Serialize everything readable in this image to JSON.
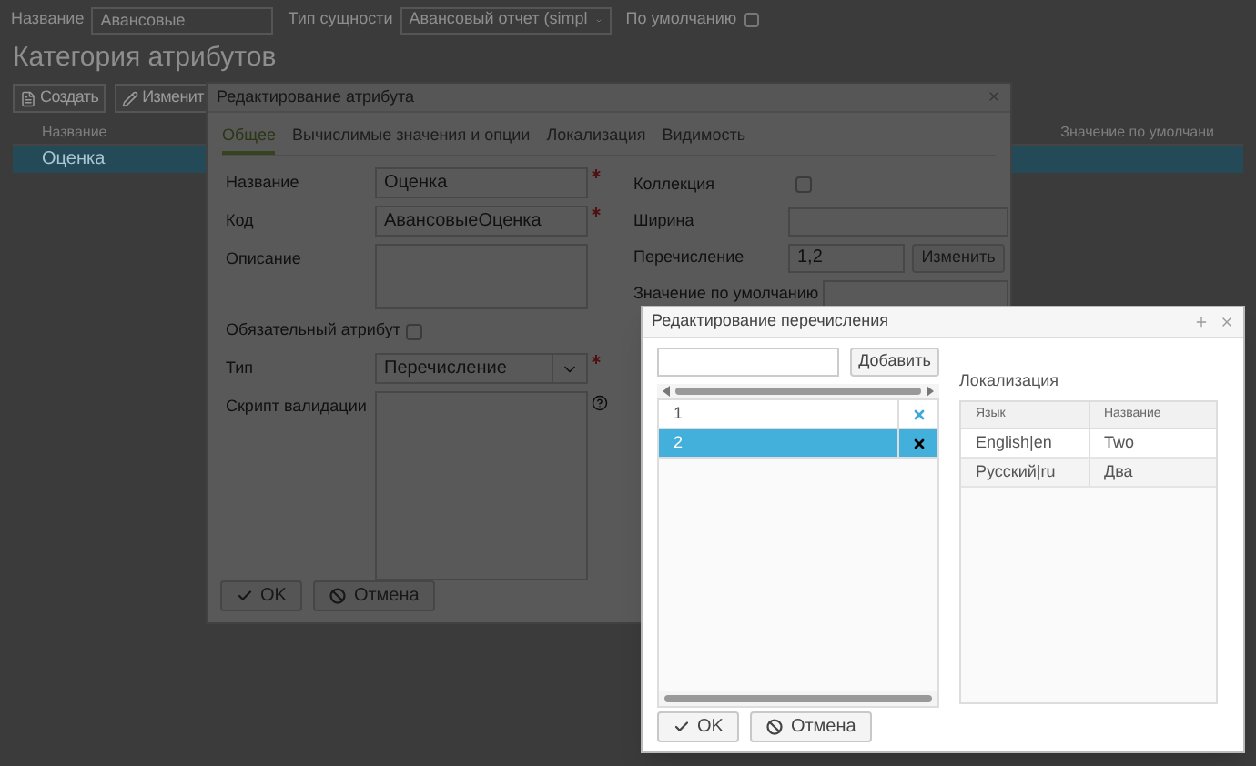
{
  "page": {
    "filters": [
      {
        "kind": "text",
        "label": "Название",
        "value": "Авансовые"
      },
      {
        "kind": "select",
        "label": "Тип сущности",
        "value": "Авансовый отчет (simpl"
      },
      {
        "kind": "checkbox",
        "label": "По умолчанию",
        "checked": false
      }
    ],
    "title": "Категория атрибутов",
    "buttons": [
      {
        "kind": "create",
        "label": "Создать"
      },
      {
        "kind": "edit",
        "label": "Изменит"
      }
    ],
    "table": {
      "columns": [
        "Название",
        "Значение по умолчани"
      ],
      "rows": [
        {
          "cells": [
            "Оценка"
          ],
          "selected": true
        }
      ]
    }
  },
  "attribute_dialog": {
    "title": "Редактирование атрибута",
    "tabs": [
      {
        "label": "Общее",
        "selected": true
      },
      {
        "label": "Вычислимые значения и опции",
        "selected": false
      },
      {
        "label": "Локализация",
        "selected": false
      },
      {
        "label": "Видимость",
        "selected": false
      }
    ],
    "left_fields": [
      {
        "kind": "text",
        "label": "Название",
        "value": "Оценка",
        "required": true
      },
      {
        "kind": "text",
        "label": "Код",
        "value": "АвансовыеОценка",
        "required": true
      },
      {
        "kind": "textarea",
        "label": "Описание",
        "required": false
      },
      {
        "kind": "checkbox",
        "label": "Обязательный атрибут",
        "checked": false
      },
      {
        "kind": "select",
        "label": "Тип",
        "value": "Перечисление",
        "required": true
      },
      {
        "kind": "script",
        "label": "Скрипт валидации",
        "required": false
      }
    ],
    "right_fields": [
      {
        "kind": "checkbox",
        "label": "Коллекция",
        "checked": false
      },
      {
        "kind": "text",
        "label": "Ширина"
      },
      {
        "kind": "text_button",
        "label": "Перечисление",
        "value": "1,2",
        "button": "Изменить"
      },
      {
        "kind": "text",
        "label": "Значение по умолчанию"
      }
    ],
    "buttons": [
      {
        "kind": "ok",
        "label": "OK"
      },
      {
        "kind": "cancel",
        "label": "Отмена"
      }
    ]
  },
  "enum_dialog": {
    "title": "Редактирование перечисления",
    "add_button": "Добавить",
    "items": [
      {
        "label": "1",
        "selected": false
      },
      {
        "label": "2",
        "selected": true
      }
    ],
    "localization": {
      "title": "Локализация",
      "columns": [
        "Язык",
        "Название"
      ],
      "rows": [
        [
          "English|en",
          "Two"
        ],
        [
          "Русский|ru",
          "Два"
        ]
      ]
    },
    "buttons": [
      {
        "kind": "ok",
        "label": "OK"
      },
      {
        "kind": "cancel",
        "label": "Отмена"
      }
    ]
  }
}
